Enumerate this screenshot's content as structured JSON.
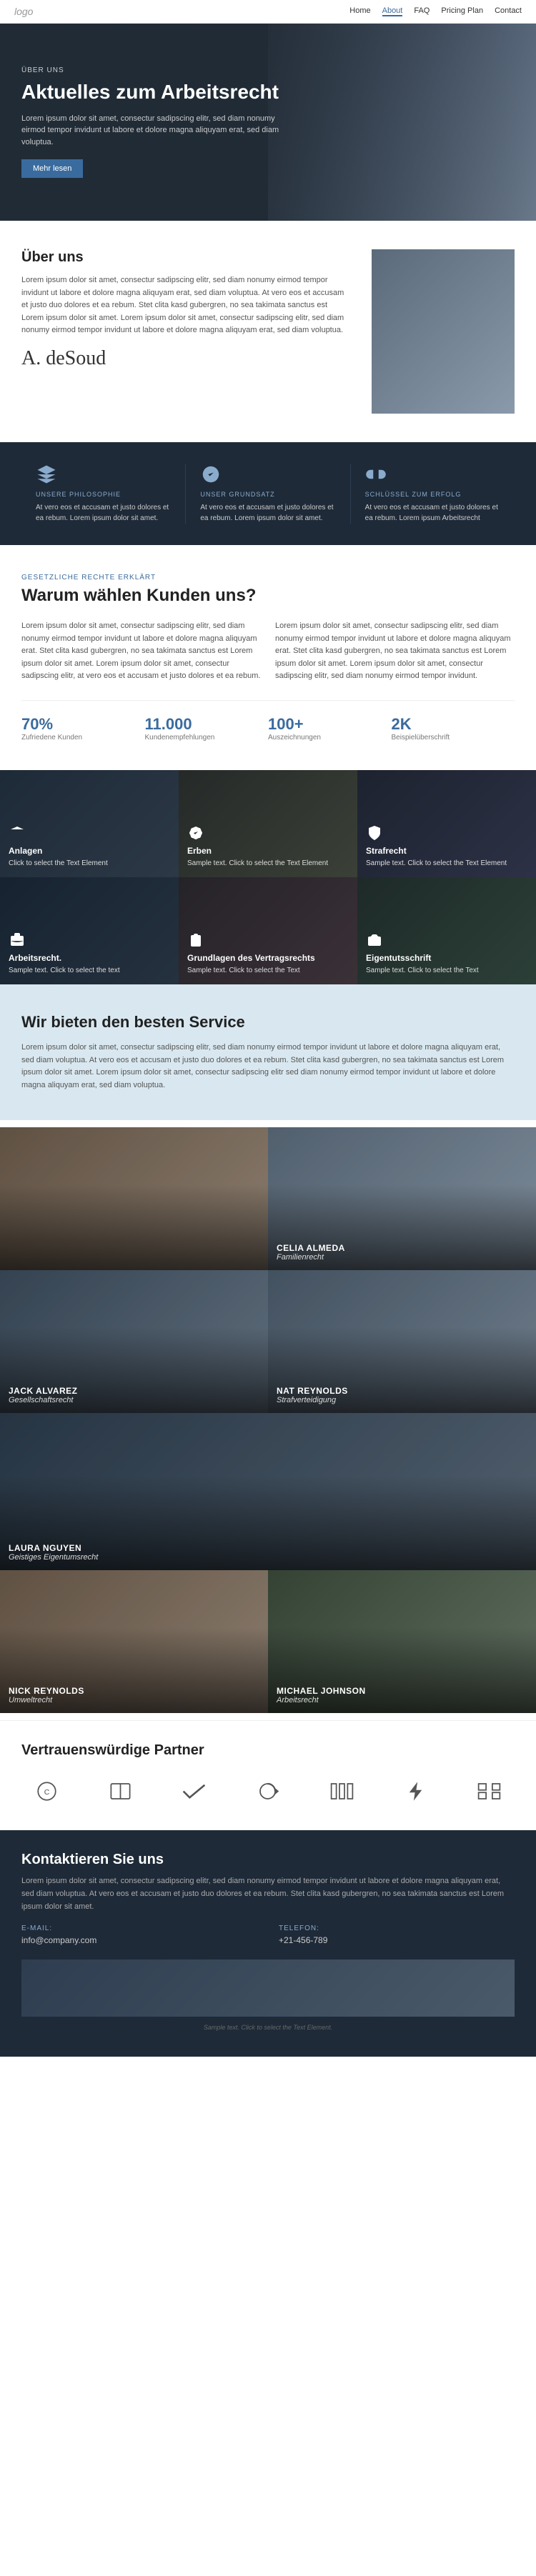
{
  "nav": {
    "logo": "logo",
    "links": [
      {
        "label": "Home",
        "active": false
      },
      {
        "label": "About",
        "active": true
      },
      {
        "label": "FAQ",
        "active": false
      },
      {
        "label": "Pricing Plan",
        "active": false
      },
      {
        "label": "Contact",
        "active": false
      }
    ]
  },
  "hero": {
    "subtitle": "ÜBER UNS",
    "title": "Aktuelles zum Arbeitsrecht",
    "text": "Lorem ipsum dolor sit amet, consectur sadipscing elitr, sed diam nonumy eirmod tempor invidunt ut labore et dolore magna aliquyam erat, sed diam voluptua.",
    "btn_label": "Mehr lesen"
  },
  "about": {
    "heading": "Über uns",
    "body": "Lorem ipsum dolor sit amet, consectur sadipscing elitr, sed diam nonumy eirmod tempor invidunt ut labore et dolore magna aliquyam erat, sed diam voluptua. At vero eos et accusam et justo duo dolores et ea rebum. Stet clita kasd gubergren, no sea takimata sanctus est Lorem ipsum dolor sit amet. Lorem ipsum dolor sit amet, consectur sadipscing elitr, sed diam nonumy eirmod tempor invidunt ut labore et dolore magna aliquyam erat, sed diam voluptua.",
    "signature": "A. deSoud"
  },
  "philosophy": {
    "items": [
      {
        "label": "UNSERE PHILOSOPHIE",
        "text": "At vero eos et accusam et justo dolores et ea rebum. Lorem ipsum dolor sit amet."
      },
      {
        "label": "UNSER GRUNDSATZ",
        "text": "At vero eos et accusam et justo dolores et ea rebum. Lorem ipsum dolor sit amet."
      },
      {
        "label": "SCHLÜSSEL ZUM ERFOLG",
        "text": "At vero eos et accusam et justo dolores et ea rebum. Lorem ipsum Arbeitsrecht"
      }
    ]
  },
  "why": {
    "subtitle": "GESETZLICHE RECHTE ERKLÄRT",
    "title": "Warum wählen Kunden uns?",
    "col1": "Lorem ipsum dolor sit amet, consectur sadipscing elitr, sed diam nonumy eirmod tempor invidunt ut labore et dolore magna aliquyam erat. Stet clita kasd gubergren, no sea takimata sanctus est Lorem ipsum dolor sit amet. Lorem ipsum dolor sit amet, consectur sadipscing elitr, at vero eos et accusam et justo dolores et ea rebum.",
    "col2": "Lorem ipsum dolor sit amet, consectur sadipscing elitr, sed diam nonumy eirmod tempor invidunt ut labore et dolore magna aliquyam erat. Stet clita kasd gubergren, no sea takimata sanctus est Lorem ipsum dolor sit amet. Lorem ipsum dolor sit amet, consectur sadipscing elitr, sed diam nonumy eirmod tempor invidunt.",
    "stats": [
      {
        "num": "70%",
        "label": "Zufriedene Kunden"
      },
      {
        "num": "11.000",
        "label": "Kundenempfehlungen"
      },
      {
        "num": "100+",
        "label": "Auszeichnungen"
      },
      {
        "num": "2K",
        "label": "Beispielüberschrift"
      }
    ]
  },
  "services": {
    "cards": [
      {
        "title": "Anlagen",
        "sample": "Click to select the Text Element",
        "select": "Click to select"
      },
      {
        "title": "Erben",
        "sample": "Sample text. Click to select the Text Element",
        "select": ""
      },
      {
        "title": "Strafrecht",
        "sample": "Sample text. Click to select the Text Element",
        "select": ""
      },
      {
        "title": "Arbeitsrecht.",
        "sample": "Sample text. Click to select the text",
        "select": ""
      },
      {
        "title": "Grundlagen des Vertragsrechts",
        "sample": "Sample text. Click to select the Text",
        "select": ""
      },
      {
        "title": "Eigentutsschrift",
        "sample": "Sample text. Click to select the Text",
        "select": ""
      }
    ]
  },
  "best_service": {
    "title": "Wir bieten den besten Service",
    "text": "Lorem ipsum dolor sit amet, consectur sadipscing elitr, sed diam nonumy eirmod tempor invidunt ut labore et dolore magna aliquyam erat, sed diam voluptua. At vero eos et accusam et justo duo dolores et ea rebum. Stet clita kasd gubergren, no sea takimata sanctus est Lorem ipsum dolor sit amet. Lorem ipsum dolor sit amet, consectur sadipscing elitr sed diam nonumy eirmod tempor invidunt ut labore et dolore magna aliquyam erat, sed diam voluptua."
  },
  "team": {
    "members": [
      {
        "name": "CELIA ALMEDA",
        "role": "Familienrecht"
      },
      {
        "name": "JACK ALVAREZ",
        "role": "Gesellschaftsrecht"
      },
      {
        "name": "NAT REYNOLDS",
        "role": "Strafverteidigung"
      },
      {
        "name": "LAURA NGUYEN",
        "role": "Geistiges Eigentumsrecht"
      },
      {
        "name": "NICK REYNOLDS",
        "role": "Umweltrecht"
      },
      {
        "name": "MICHAEL JOHNSON",
        "role": "Arbeitsrecht"
      }
    ]
  },
  "partners": {
    "title": "Vertrauenswürdige Partner",
    "logos": [
      {
        "name": "COMPANY 1"
      },
      {
        "name": "COMPANY 2"
      },
      {
        "name": "COMPANY 3"
      },
      {
        "name": "COMPANY 4"
      },
      {
        "name": "COMPANY 5"
      },
      {
        "name": "COMPANY 6"
      },
      {
        "name": "COMPANY 7"
      }
    ]
  },
  "contact": {
    "title": "Kontaktieren Sie uns",
    "text": "Lorem ipsum dolor sit amet, consectur sadipscing elitr, sed diam nonumy eirmod tempor invidunt ut labore et dolore magna aliquyam erat, sed diam voluptua. At vero eos et accusam et justo duo dolores et ea rebum. Stet clita kasd gubergren, no sea takimata sanctus est Lorem ipsum dolor sit amet.",
    "email_label": "E-Mail:",
    "email_value": "info@company.com",
    "phone_label": "Telefon:",
    "phone_value": "+21-456-789",
    "select_text": "Sample text. Click to select the Text Element."
  }
}
